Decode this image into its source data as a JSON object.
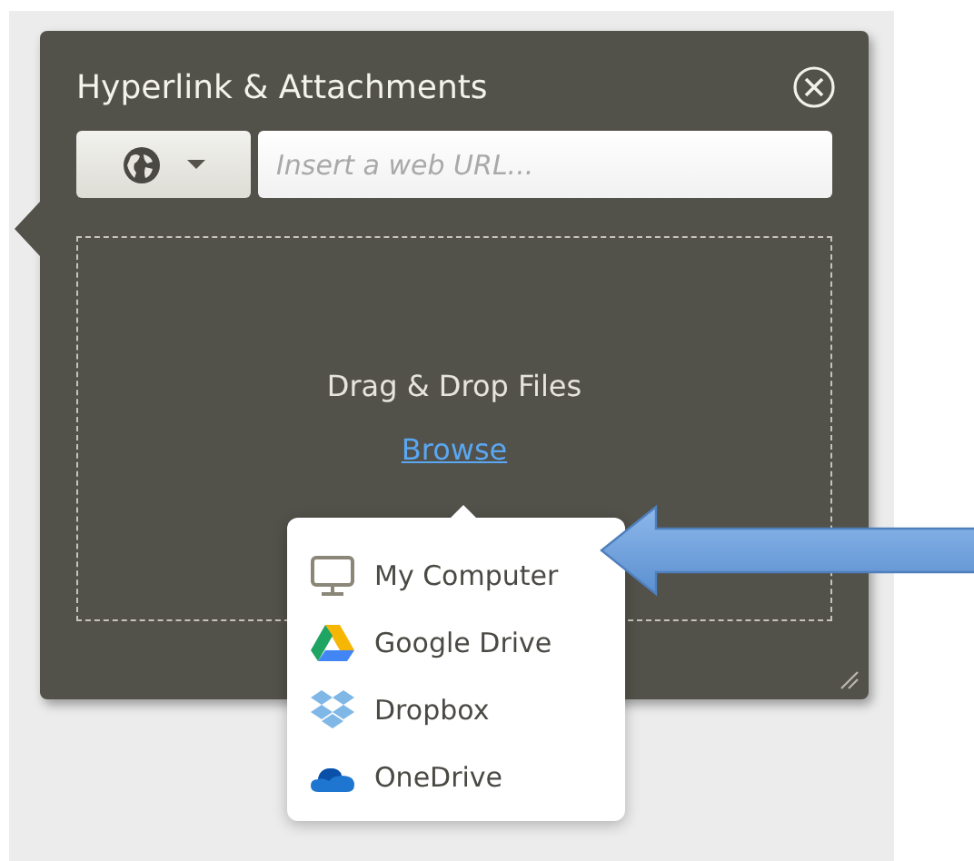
{
  "dialog": {
    "title": "Hyperlink & Attachments",
    "url_field": {
      "placeholder": "Insert a web URL..."
    },
    "drop_zone": {
      "label": "Drag & Drop Files",
      "link": "Browse"
    }
  },
  "source_menu": {
    "items": [
      {
        "label": "My Computer",
        "kind": "computer"
      },
      {
        "label": "Google Drive",
        "kind": "gdrive"
      },
      {
        "label": "Dropbox",
        "kind": "dropbox"
      },
      {
        "label": "OneDrive",
        "kind": "onedrive"
      }
    ]
  }
}
